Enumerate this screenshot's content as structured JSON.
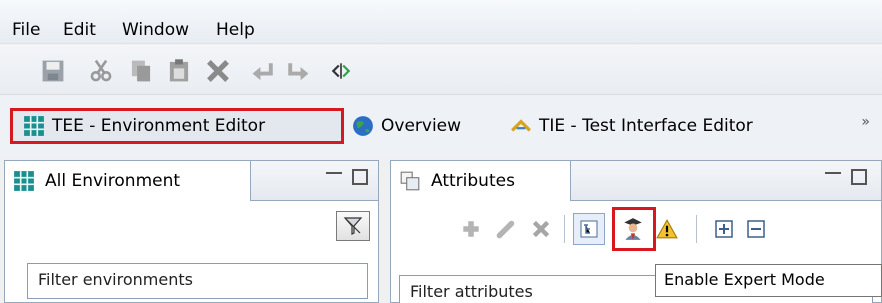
{
  "menu": [
    "File",
    "Edit",
    "Window",
    "Help"
  ],
  "toolbar": {
    "icons": [
      "save-icon",
      "cut-icon",
      "copy-icon",
      "paste-icon",
      "delete-icon",
      "undo-icon",
      "redo-icon",
      "switch-editor-icon"
    ]
  },
  "perspectives": {
    "active": "TEE - Environment Editor",
    "overview": "Overview",
    "tie": "TIE - Test Interface Editor",
    "overflow": "»"
  },
  "left_view": {
    "tab": "All Environment",
    "filter_placeholder": "Filter environments"
  },
  "right_view": {
    "tab": "Attributes",
    "filter_placeholder": "Filter attributes",
    "actions": [
      "add-icon",
      "edit-icon",
      "remove-icon",
      "tree-view-icon",
      "expert-mode-icon",
      "warning-icon",
      "expand-all-icon",
      "collapse-all-icon"
    ]
  },
  "tooltip": "Enable Expert Mode",
  "colors": {
    "highlight": "#d8181f",
    "view_border": "#98a8bc",
    "toolbar_bg": "#e9edf2"
  }
}
